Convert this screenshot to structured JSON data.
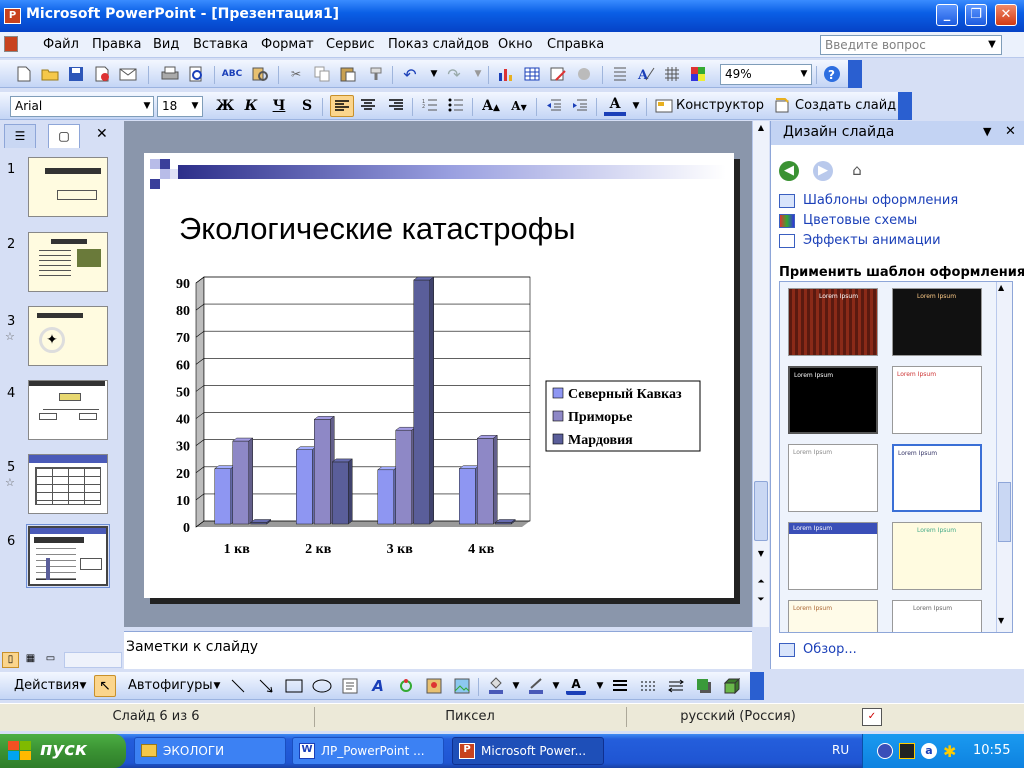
{
  "window": {
    "title": "Microsoft PowerPoint - [Презентация1]",
    "app_icon_letter": "P",
    "colors": {
      "titlebar": "#0a5fe6",
      "menubar": "#ebf1fc",
      "slide_area": "#8a96ab"
    }
  },
  "menu": {
    "items": [
      "Файл",
      "Правка",
      "Вид",
      "Вставка",
      "Формат",
      "Сервис",
      "Показ слайдов",
      "Окно",
      "Справка"
    ],
    "ask_placeholder": "Введите вопрос"
  },
  "toolbar_standard": {
    "zoom": "49%"
  },
  "toolbar_format": {
    "font": "Arial",
    "size": "18",
    "bold": "Ж",
    "italic": "К",
    "underline": "Ч",
    "shadow": "S",
    "designer": "Конструктор",
    "new_slide": "Создать слайд"
  },
  "left_panel": {
    "thumb_numbers": [
      "1",
      "2",
      "3",
      "4",
      "5",
      "6"
    ],
    "selected": 6
  },
  "slide": {
    "title": "Экологические катастрофы"
  },
  "chart_data": {
    "type": "bar",
    "categories": [
      "1 кв",
      "2 кв",
      "3 кв",
      "4 кв"
    ],
    "series": [
      {
        "name": "Северный Кавказ",
        "values": [
          20.4,
          27.4,
          20,
          20.4
        ],
        "color": "#8e96f2"
      },
      {
        "name": "Приморье",
        "values": [
          30.6,
          38.6,
          34.6,
          31.6
        ],
        "color": "#8e88c6"
      },
      {
        "name": "Мардовия",
        "values": [
          0,
          22.9,
          90,
          0.5
        ],
        "color": "#5a5e9a"
      }
    ],
    "y_ticks": [
      "0",
      "10",
      "20",
      "30",
      "40",
      "50",
      "60",
      "70",
      "80",
      "90"
    ],
    "ylim": [
      0,
      90
    ],
    "grid": true,
    "legend": "right"
  },
  "notes": {
    "placeholder": "Заметки к слайду"
  },
  "task_pane": {
    "title": "Дизайн слайда",
    "links": [
      "Шаблоны оформления",
      "Цветовые схемы",
      "Эффекты анимации"
    ],
    "apply_label": "Применить шаблон оформления:",
    "browse": "Обзор...",
    "lorem": "Lorem Ipsum"
  },
  "draw_toolbar": {
    "actions": "Действия",
    "autoshapes": "Автофигуры"
  },
  "status": {
    "slide": "Слайд 6 из 6",
    "design": "Пиксел",
    "language": "русский (Россия)"
  },
  "taskbar": {
    "start": "пуск",
    "buttons": [
      "ЭКОЛОГИ",
      "ЛР_PowerPoint ...",
      "Microsoft Power..."
    ],
    "lang": "RU",
    "clock": "10:55"
  }
}
